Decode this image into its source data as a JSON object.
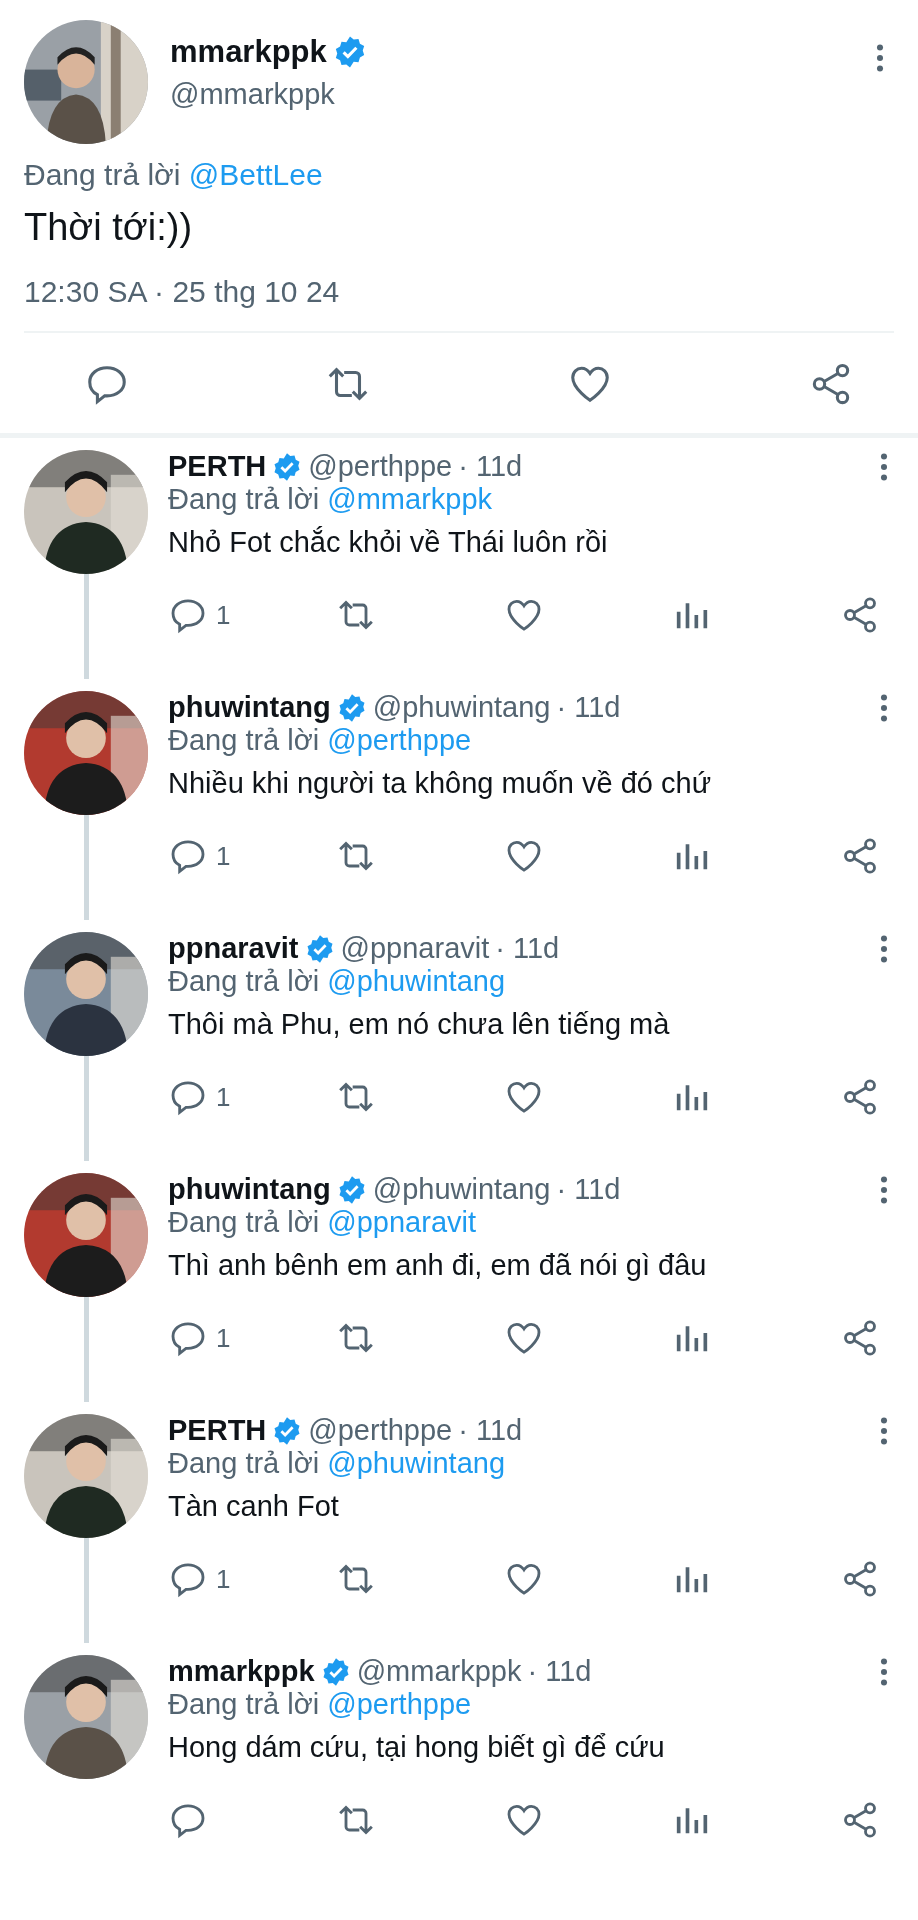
{
  "main_tweet": {
    "name": "mmarkppk",
    "verified": true,
    "handle": "@mmarkppk",
    "reply_prefix": "Đang trả lời",
    "reply_to": "@BettLee",
    "text": "Thời tới:))",
    "timestamp": "12:30 SA · 25 thg 10 24"
  },
  "replies": [
    {
      "name": "PERTH",
      "verified": true,
      "handle": "@perthppe",
      "time": "· 11d",
      "reply_prefix": "Đang trả lời",
      "reply_to": "@mmarkppk",
      "text": "Nhỏ Fot chắc khỏi về Thái luôn rồi",
      "reply_count": "1"
    },
    {
      "name": "phuwintang",
      "verified": true,
      "handle": "@phuwintang",
      "time": "· 11d",
      "reply_prefix": "Đang trả lời",
      "reply_to": "@perthppe",
      "text": "Nhiều khi người ta không muốn về đó chứ",
      "reply_count": "1"
    },
    {
      "name": "ppnaravit",
      "verified": true,
      "handle": "@ppnaravit",
      "time": "· 11d",
      "reply_prefix": "Đang trả lời",
      "reply_to": "@phuwintang",
      "text": "Thôi mà Phu, em nó chưa lên tiếng mà",
      "reply_count": "1"
    },
    {
      "name": "phuwintang",
      "verified": true,
      "handle": "@phuwintang",
      "time": "· 11d",
      "reply_prefix": "Đang trả lời",
      "reply_to": "@ppnaravit",
      "text": "Thì anh bênh em anh đi, em đã nói gì đâu",
      "reply_count": "1"
    },
    {
      "name": "PERTH",
      "verified": true,
      "handle": "@perthppe",
      "time": "· 11d",
      "reply_prefix": "Đang trả lời",
      "reply_to": "@phuwintang",
      "text": "Tàn canh Fot",
      "reply_count": "1"
    },
    {
      "name": "mmarkppk",
      "verified": true,
      "handle": "@mmarkppk",
      "time": "· 11d",
      "reply_prefix": "Đang trả lời",
      "reply_to": "@perthppe",
      "text": "Hong dám cứu, tại hong biết gì để cứu"
    }
  ]
}
